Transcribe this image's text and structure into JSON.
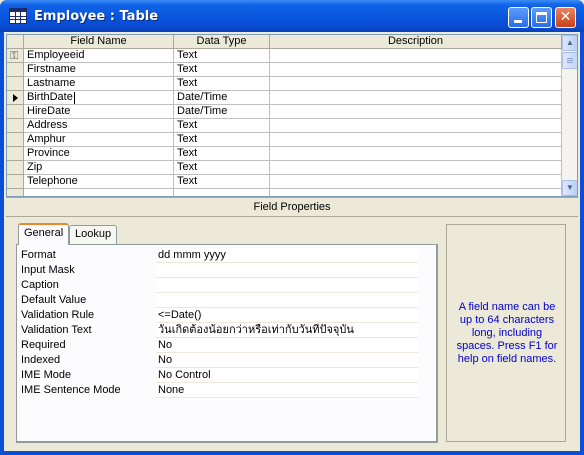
{
  "window": {
    "title": "Employee : Table"
  },
  "grid": {
    "headers": {
      "name": "Field Name",
      "type": "Data Type",
      "desc": "Description"
    },
    "rows": [
      {
        "name": "Employeeid",
        "type": "Text",
        "desc": ""
      },
      {
        "name": "Firstname",
        "type": "Text",
        "desc": ""
      },
      {
        "name": "Lastname",
        "type": "Text",
        "desc": ""
      },
      {
        "name": "BirthDate",
        "type": "Date/Time",
        "desc": ""
      },
      {
        "name": "HireDate",
        "type": "Date/Time",
        "desc": ""
      },
      {
        "name": "Address",
        "type": "Text",
        "desc": ""
      },
      {
        "name": "Amphur",
        "type": "Text",
        "desc": ""
      },
      {
        "name": "Province",
        "type": "Text",
        "desc": ""
      },
      {
        "name": "Zip",
        "type": "Text",
        "desc": ""
      },
      {
        "name": "Telephone",
        "type": "Text",
        "desc": ""
      }
    ],
    "primary_key_row": 0,
    "current_row": 3
  },
  "field_properties": {
    "title": "Field Properties",
    "tabs": [
      {
        "label": "General"
      },
      {
        "label": "Lookup"
      }
    ],
    "active_tab": "General",
    "props": [
      {
        "label": "Format",
        "value": "dd mmm yyyy"
      },
      {
        "label": "Input Mask",
        "value": ""
      },
      {
        "label": "Caption",
        "value": ""
      },
      {
        "label": "Default Value",
        "value": ""
      },
      {
        "label": "Validation Rule",
        "value": "<=Date()"
      },
      {
        "label": "Validation Text",
        "value": "วันเกิดต้องน้อยกว่าหรือเท่ากับวันที่ปัจจุบัน"
      },
      {
        "label": "Required",
        "value": "No"
      },
      {
        "label": "Indexed",
        "value": "No"
      },
      {
        "label": "IME Mode",
        "value": "No Control"
      },
      {
        "label": "IME Sentence Mode",
        "value": "None"
      }
    ],
    "help_text": "A field name can be up to 64 characters long, including spaces.  Press F1 for help on field names."
  },
  "icons": {
    "app": "table-grid-icon",
    "key": "primary-key-icon",
    "pointer": "record-pointer-icon"
  },
  "colors": {
    "titlebar": "#0855dd",
    "help_text": "#0000cc",
    "face": "#ece9d8"
  }
}
